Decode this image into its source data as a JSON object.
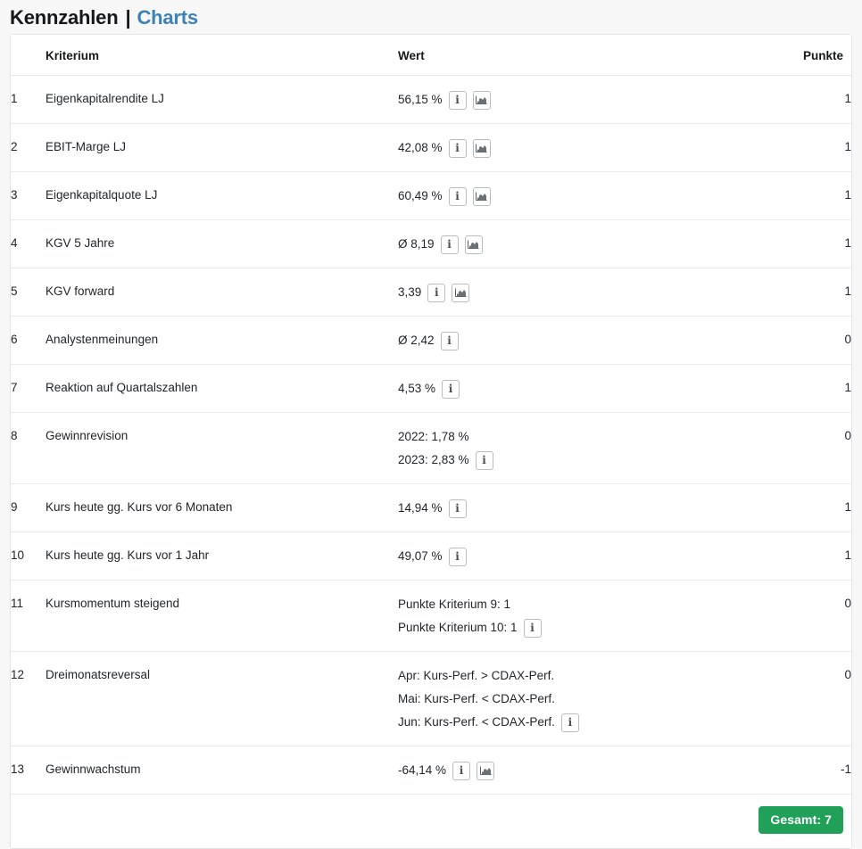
{
  "header": {
    "title": "Kennzahlen",
    "separator": "|",
    "link": "Charts"
  },
  "table": {
    "columns": {
      "num": "",
      "criterion": "Kriterium",
      "value": "Wert",
      "points": "Punkte"
    },
    "rows": [
      {
        "num": "1",
        "criterion": "Eigenkapitalrendite LJ",
        "value_lines": [
          {
            "text": "56,15 %",
            "icons": [
              "info-icon",
              "chart-icon"
            ]
          }
        ],
        "points": "1"
      },
      {
        "num": "2",
        "criterion": "EBIT-Marge LJ",
        "value_lines": [
          {
            "text": "42,08 %",
            "icons": [
              "info-icon",
              "chart-icon"
            ]
          }
        ],
        "points": "1"
      },
      {
        "num": "3",
        "criterion": "Eigenkapitalquote LJ",
        "value_lines": [
          {
            "text": "60,49 %",
            "icons": [
              "info-icon",
              "chart-icon"
            ]
          }
        ],
        "points": "1"
      },
      {
        "num": "4",
        "criterion": "KGV 5 Jahre",
        "value_lines": [
          {
            "text": "Ø 8,19",
            "icons": [
              "info-icon",
              "chart-icon"
            ]
          }
        ],
        "points": "1"
      },
      {
        "num": "5",
        "criterion": "KGV forward",
        "value_lines": [
          {
            "text": "3,39",
            "icons": [
              "info-icon",
              "chart-icon"
            ]
          }
        ],
        "points": "1"
      },
      {
        "num": "6",
        "criterion": "Analystenmeinungen",
        "value_lines": [
          {
            "text": "Ø 2,42",
            "icons": [
              "info-icon"
            ]
          }
        ],
        "points": "0"
      },
      {
        "num": "7",
        "criterion": "Reaktion auf Quartalszahlen",
        "value_lines": [
          {
            "text": "4,53 %",
            "icons": [
              "info-icon"
            ]
          }
        ],
        "points": "1"
      },
      {
        "num": "8",
        "criterion": "Gewinnrevision",
        "value_lines": [
          {
            "text": "2022: 1,78 %",
            "icons": []
          },
          {
            "text": "2023: 2,83 %",
            "icons": [
              "info-icon"
            ]
          }
        ],
        "points": "0"
      },
      {
        "num": "9",
        "criterion": "Kurs heute gg. Kurs vor 6 Monaten",
        "value_lines": [
          {
            "text": "14,94 %",
            "icons": [
              "info-icon"
            ]
          }
        ],
        "points": "1"
      },
      {
        "num": "10",
        "criterion": "Kurs heute gg. Kurs vor 1 Jahr",
        "value_lines": [
          {
            "text": "49,07 %",
            "icons": [
              "info-icon"
            ]
          }
        ],
        "points": "1"
      },
      {
        "num": "11",
        "criterion": "Kursmomentum steigend",
        "value_lines": [
          {
            "text": "Punkte Kriterium 9: 1",
            "icons": []
          },
          {
            "text": "Punkte Kriterium 10: 1",
            "icons": [
              "info-icon"
            ]
          }
        ],
        "points": "0"
      },
      {
        "num": "12",
        "criterion": "Dreimonatsreversal",
        "value_lines": [
          {
            "text": "Apr: Kurs-Perf. > CDAX-Perf.",
            "icons": []
          },
          {
            "text": "Mai: Kurs-Perf. < CDAX-Perf.",
            "icons": []
          },
          {
            "text": "Jun: Kurs-Perf. < CDAX-Perf.",
            "icons": [
              "info-icon"
            ]
          }
        ],
        "points": "0"
      },
      {
        "num": "13",
        "criterion": "Gewinnwachstum",
        "value_lines": [
          {
            "text": "-64,14 %",
            "icons": [
              "info-icon",
              "chart-icon"
            ]
          }
        ],
        "points": "-1"
      }
    ]
  },
  "footer": {
    "total_badge": "Gesamt: 7"
  },
  "colors": {
    "link": "#3d81b5",
    "badge_green": "#21a05a",
    "text": "#212529",
    "border": "#e9eaec",
    "page_background": "#f7f7f8"
  }
}
